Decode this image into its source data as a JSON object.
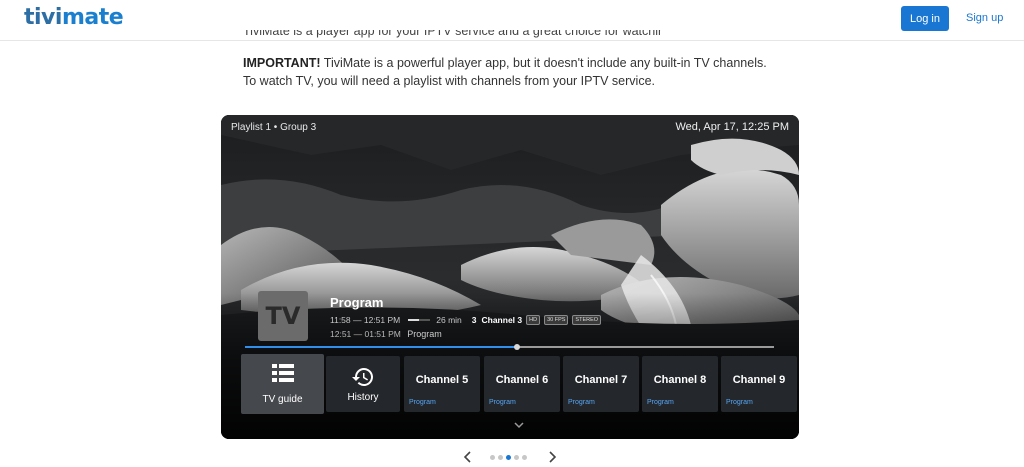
{
  "header": {
    "logo_part1": "tivi",
    "logo_part2": "mate",
    "login_label": "Log in",
    "signup_label": "Sign up"
  },
  "intro": {
    "cropped_line": "TiviMate is a player app for your IPTV service and a great choice for watching live TV on your device.",
    "important_label": "IMPORTANT!",
    "important_text": " TiviMate is a powerful player app, but it doesn't include any built-in TV channels. To watch TV, you will need a playlist with channels from your IPTV service."
  },
  "player": {
    "breadcrumb": "Playlist 1  •  Group 3",
    "datetime": "Wed, Apr 17, 12:25 PM",
    "channel_logo": "TV",
    "program_title": "Program",
    "current_time_range": "11:58 — 12:51 PM",
    "current_progress": 0.5,
    "remaining": "26 min",
    "channel_number": "3",
    "channel_name": "Channel 3",
    "badges": [
      "HD",
      "30 FPS",
      "STEREO"
    ],
    "next_time_range": "12:51 — 01:51 PM",
    "next_program": "Program",
    "seek_progress": 0.515,
    "menu": {
      "tv_guide_label": "TV guide",
      "history_label": "History"
    },
    "channels": [
      {
        "name": "Channel 5",
        "program": "Program"
      },
      {
        "name": "Channel 6",
        "program": "Program"
      },
      {
        "name": "Channel 7",
        "program": "Program"
      },
      {
        "name": "Channel 8",
        "program": "Program"
      },
      {
        "name": "Channel 9",
        "program": "Program"
      }
    ]
  },
  "carousel": {
    "slide_count": 5,
    "active_slide": 3,
    "active_color": "#1976d2",
    "inactive_color": "#c7c7c7"
  },
  "colors": {
    "brand_blue": "#1976d2",
    "accent_blue": "#2f8fea"
  }
}
